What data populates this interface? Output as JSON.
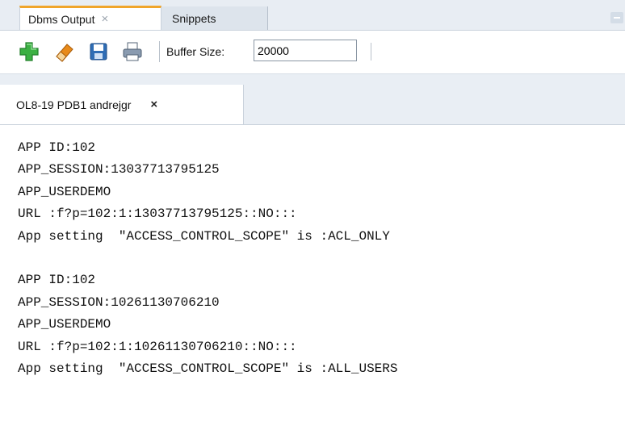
{
  "tabs": [
    {
      "label": "Dbms Output",
      "close": "×",
      "active": true
    },
    {
      "label": "Snippets",
      "active": false
    }
  ],
  "toolbar": {
    "icons": [
      "add-icon",
      "eraser-icon",
      "save-icon",
      "print-icon"
    ],
    "buffer_label": "Buffer Size:",
    "buffer_value": "20000"
  },
  "connection_tab": {
    "label": "OL8-19 PDB1 andrejgr",
    "close": "×"
  },
  "output_lines": [
    "APP ID:102",
    "APP_SESSION:13037713795125",
    "APP_USERDEMO",
    "URL :f?p=102:1:13037713795125::NO:::",
    "App setting  \"ACCESS_CONTROL_SCOPE\" is :ACL_ONLY",
    "",
    "APP ID:102",
    "APP_SESSION:10261130706210",
    "APP_USERDEMO",
    "URL :f?p=102:1:10261130706210::NO:::",
    "App setting  \"ACCESS_CONTROL_SCOPE\" is :ALL_USERS"
  ],
  "colors": {
    "active_tab_accent": "#f0a52a",
    "add_icon": "#3cb043",
    "eraser_icon": "#e88a1a",
    "save_icon": "#2f6db5"
  }
}
